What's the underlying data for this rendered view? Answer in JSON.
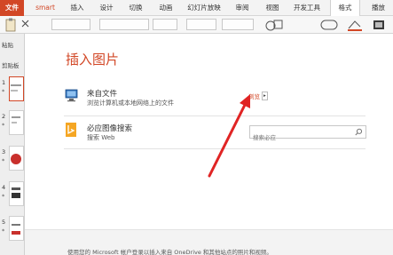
{
  "ribbon": {
    "tabs": [
      {
        "label": "文件"
      },
      {
        "label": "smart"
      },
      {
        "label": "插入"
      },
      {
        "label": "设计"
      },
      {
        "label": "切换"
      },
      {
        "label": "动画"
      },
      {
        "label": "幻灯片放映"
      },
      {
        "label": "审阅"
      },
      {
        "label": "视图"
      },
      {
        "label": "开发工具"
      },
      {
        "label": "格式"
      },
      {
        "label": "播放"
      }
    ]
  },
  "left_panel": {
    "paste_label": "粘贴",
    "clipboard_label": "剪贴板",
    "slide_numbers": [
      "1",
      "2",
      "3",
      "4",
      "5"
    ],
    "star": "*"
  },
  "dialog": {
    "title": "插入图片",
    "from_file": {
      "title": "来自文件",
      "subtitle": "浏览计算机或本地网络上的文件",
      "browse_label": "浏览"
    },
    "bing": {
      "title": "必应图像搜索",
      "subtitle": "搜索 Web",
      "search_placeholder": "搜索必应"
    },
    "footer_text": "使用您的 Microsoft 帐户登录以插入来自 OneDrive 和其他站点的照片和视频。"
  },
  "colors": {
    "accent": "#d24726",
    "bing": "#f5a623"
  }
}
